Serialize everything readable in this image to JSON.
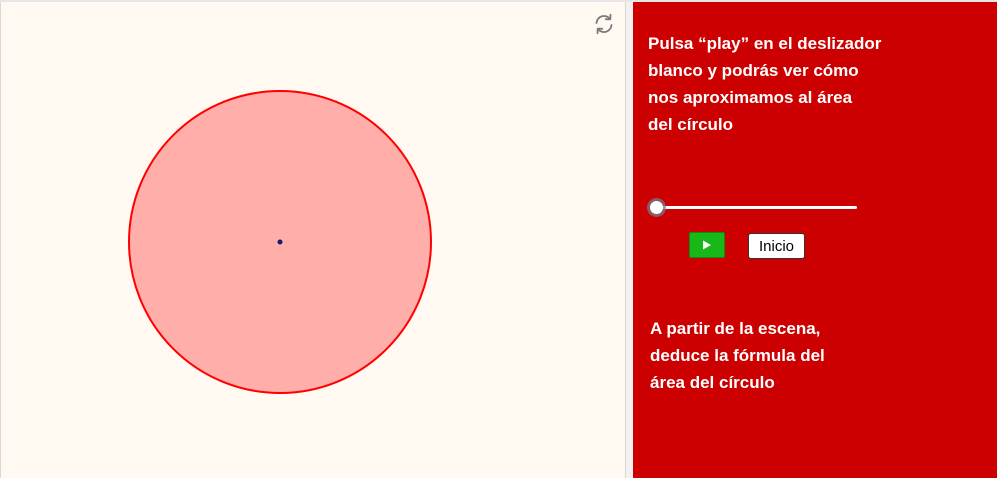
{
  "colors": {
    "canvas_bg": "#fff9f2",
    "panel_bg": "#cc0000",
    "circle_fill": "#ffaeaa",
    "circle_stroke": "#ff0000",
    "center_point": "#1a1a66",
    "play_button": "#18b818",
    "panel_text": "#ffffff"
  },
  "toolbar": {
    "reset_icon": "refresh-icon"
  },
  "panel": {
    "instruction_text": "Pulsa “play” en el deslizador\nblanco y podrás ver cómo\nnos aproximamos al área\ndel círculo",
    "slider_value": 0,
    "play_icon": "play-icon",
    "inicio_label": "Inicio",
    "question_text": "A partir de la escena,\ndeduce la fórmula del\nárea del círculo"
  }
}
